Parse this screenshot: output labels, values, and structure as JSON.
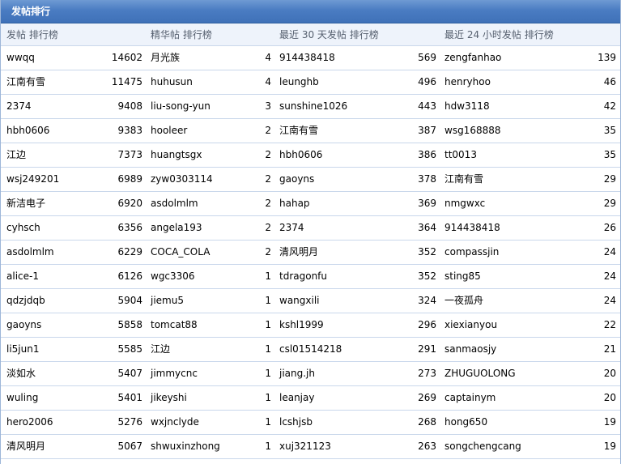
{
  "panel": {
    "title": "发帖排行"
  },
  "columns": {
    "posts": "发帖  排行榜",
    "digest": "精华帖  排行榜",
    "recent30": "最近  30 天发帖  排行榜",
    "recent24": "最近  24 小时发帖  排行榜"
  },
  "rows": [
    {
      "c1_name": "wwqq",
      "c1_val": "14602",
      "c2_name": "月光族",
      "c2_val": "4",
      "c3_name": "914438418",
      "c3_val": "569",
      "c4_name": "zengfanhao",
      "c4_val": "139"
    },
    {
      "c1_name": "江南有雪",
      "c1_val": "11475",
      "c2_name": "huhusun",
      "c2_val": "4",
      "c3_name": "leunghb",
      "c3_val": "496",
      "c4_name": "henryhoo",
      "c4_val": "46"
    },
    {
      "c1_name": "2374",
      "c1_val": "9408",
      "c2_name": "liu-song-yun",
      "c2_val": "3",
      "c3_name": "sunshine1026",
      "c3_val": "443",
      "c4_name": "hdw3118",
      "c4_val": "42"
    },
    {
      "c1_name": "hbh0606",
      "c1_val": "9383",
      "c2_name": "hooleer",
      "c2_val": "2",
      "c3_name": "江南有雪",
      "c3_val": "387",
      "c4_name": "wsg168888",
      "c4_val": "35"
    },
    {
      "c1_name": "江边",
      "c1_val": "7373",
      "c2_name": "huangtsgx",
      "c2_val": "2",
      "c3_name": "hbh0606",
      "c3_val": "386",
      "c4_name": "tt0013",
      "c4_val": "35"
    },
    {
      "c1_name": "wsj249201",
      "c1_val": "6989",
      "c2_name": "zyw0303114",
      "c2_val": "2",
      "c3_name": "gaoyns",
      "c3_val": "378",
      "c4_name": "江南有雪",
      "c4_val": "29"
    },
    {
      "c1_name": "新洁电子",
      "c1_val": "6920",
      "c2_name": "asdolmlm",
      "c2_val": "2",
      "c3_name": "hahap",
      "c3_val": "369",
      "c4_name": "nmgwxc",
      "c4_val": "29"
    },
    {
      "c1_name": "cyhsch",
      "c1_val": "6356",
      "c2_name": "angela193",
      "c2_val": "2",
      "c3_name": "2374",
      "c3_val": "364",
      "c4_name": "914438418",
      "c4_val": "26"
    },
    {
      "c1_name": "asdolmlm",
      "c1_val": "6229",
      "c2_name": "COCA_COLA",
      "c2_val": "2",
      "c3_name": "清风明月",
      "c3_val": "352",
      "c4_name": "compassjin",
      "c4_val": "24"
    },
    {
      "c1_name": "alice-1",
      "c1_val": "6126",
      "c2_name": "wgc3306",
      "c2_val": "1",
      "c3_name": "tdragonfu",
      "c3_val": "352",
      "c4_name": "sting85",
      "c4_val": "24"
    },
    {
      "c1_name": "qdzjdqb",
      "c1_val": "5904",
      "c2_name": "jiemu5",
      "c2_val": "1",
      "c3_name": "wangxili",
      "c3_val": "324",
      "c4_name": "一夜孤舟",
      "c4_val": "24"
    },
    {
      "c1_name": "gaoyns",
      "c1_val": "5858",
      "c2_name": "tomcat88",
      "c2_val": "1",
      "c3_name": "kshl1999",
      "c3_val": "296",
      "c4_name": "xiexianyou",
      "c4_val": "22"
    },
    {
      "c1_name": "li5jun1",
      "c1_val": "5585",
      "c2_name": "江边",
      "c2_val": "1",
      "c3_name": "csl01514218",
      "c3_val": "291",
      "c4_name": "sanmaosjy",
      "c4_val": "21"
    },
    {
      "c1_name": "淡如水",
      "c1_val": "5407",
      "c2_name": "jimmycnc",
      "c2_val": "1",
      "c3_name": "jiang.jh",
      "c3_val": "273",
      "c4_name": "ZHUGUOLONG",
      "c4_val": "20"
    },
    {
      "c1_name": "wuling",
      "c1_val": "5401",
      "c2_name": "jikeyshi",
      "c2_val": "1",
      "c3_name": "leanjay",
      "c3_val": "269",
      "c4_name": "captainym",
      "c4_val": "20"
    },
    {
      "c1_name": "hero2006",
      "c1_val": "5276",
      "c2_name": "wxjnclyde",
      "c2_val": "1",
      "c3_name": "lcshjsb",
      "c3_val": "268",
      "c4_name": "hong650",
      "c4_val": "19"
    },
    {
      "c1_name": "清风明月",
      "c1_val": "5067",
      "c2_name": "shwuxinzhong",
      "c2_val": "1",
      "c3_name": "xuj321123",
      "c3_val": "263",
      "c4_name": "songchengcang",
      "c4_val": "19"
    }
  ]
}
